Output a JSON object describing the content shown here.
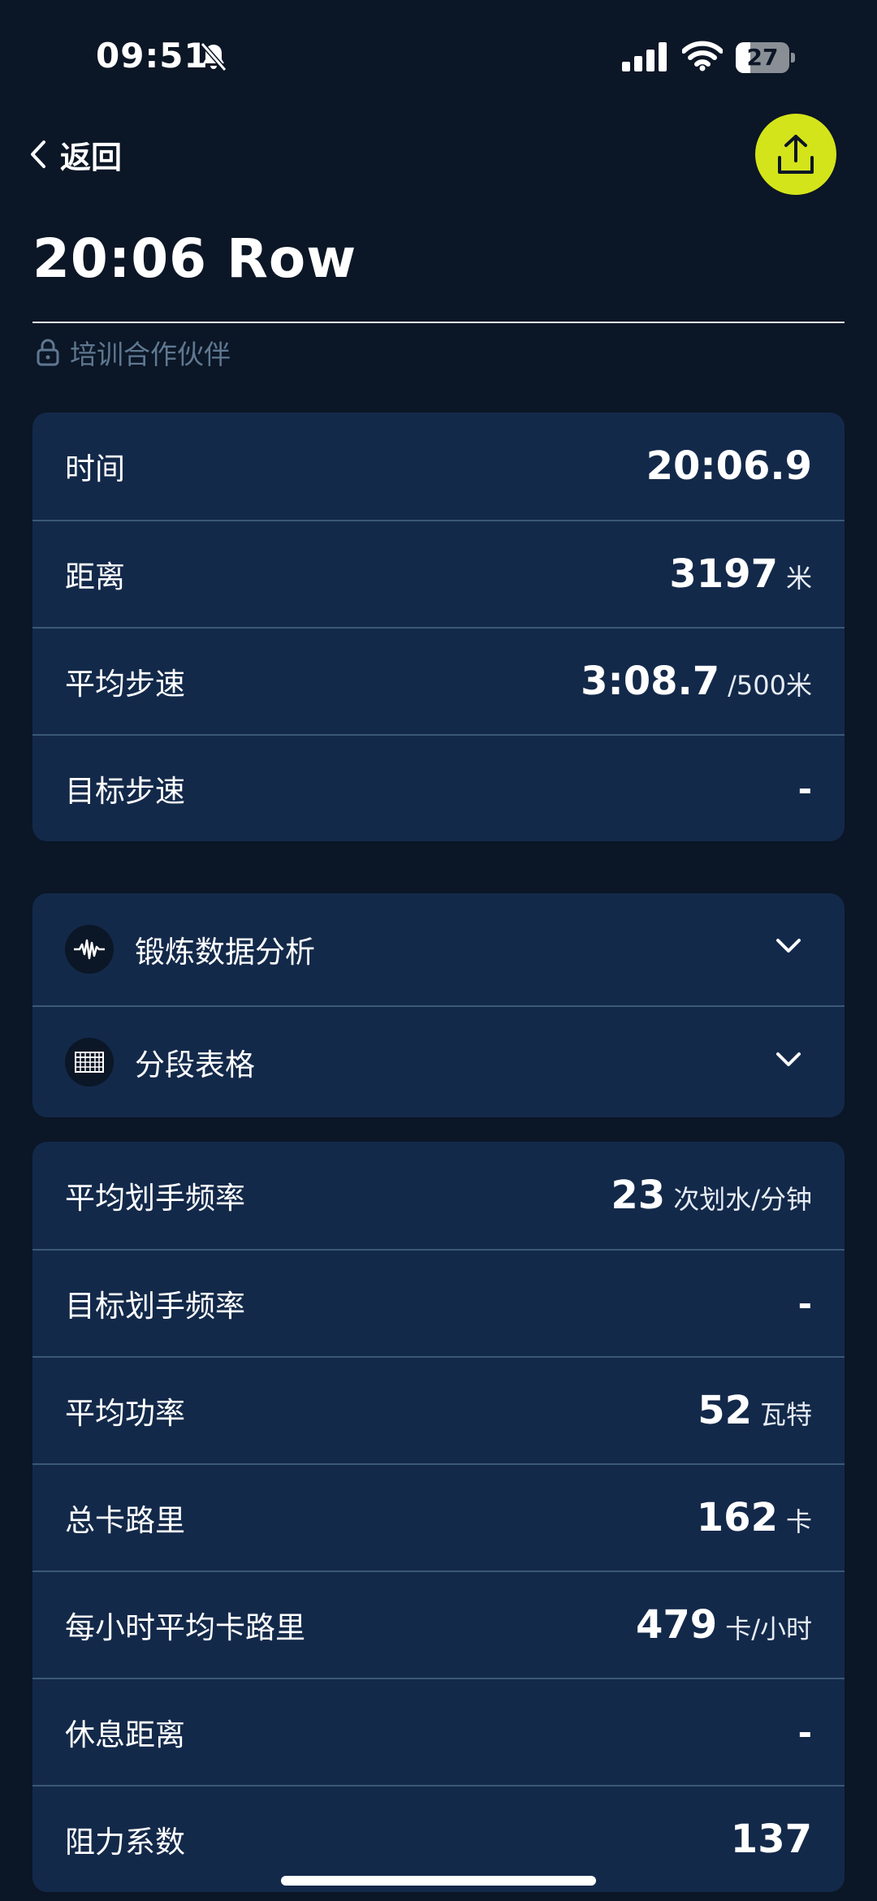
{
  "status_bar": {
    "time": "09:51",
    "battery": "27"
  },
  "header": {
    "back_label": "返回",
    "title": "20:06 Row",
    "partner_label": "培训合作伙伴"
  },
  "summary": [
    {
      "label": "时间",
      "value": "20:06.9",
      "unit": ""
    },
    {
      "label": "距离",
      "value": "3197",
      "unit": "米"
    },
    {
      "label": "平均步速",
      "value": "3:08.7",
      "unit": "/500米"
    },
    {
      "label": "目标步速",
      "value": "-",
      "unit": ""
    }
  ],
  "sections": [
    {
      "label": "锻炼数据分析",
      "icon": "waveform-icon"
    },
    {
      "label": "分段表格",
      "icon": "table-icon"
    }
  ],
  "details": [
    {
      "label": "平均划手频率",
      "value": "23",
      "unit": "次划水/分钟"
    },
    {
      "label": "目标划手频率",
      "value": "-",
      "unit": ""
    },
    {
      "label": "平均功率",
      "value": "52",
      "unit": "瓦特"
    },
    {
      "label": "总卡路里",
      "value": "162",
      "unit": "卡"
    },
    {
      "label": "每小时平均卡路里",
      "value": "479",
      "unit": "卡/小时"
    },
    {
      "label": "休息距离",
      "value": "-",
      "unit": ""
    },
    {
      "label": "阻力系数",
      "value": "137",
      "unit": ""
    }
  ],
  "colors": {
    "background": "#0b1626",
    "card": "#13294a",
    "accent": "#d4e41a",
    "muted_text": "#5f7891"
  }
}
